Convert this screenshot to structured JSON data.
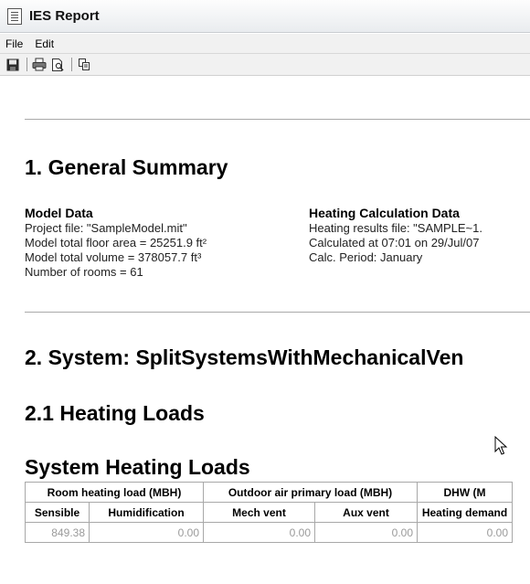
{
  "window": {
    "title": "IES Report"
  },
  "menu": {
    "items": [
      "File",
      "Edit"
    ]
  },
  "toolbar": {
    "buttons": [
      "save-icon",
      "print-icon",
      "print-preview-icon",
      "copy-icon"
    ]
  },
  "report": {
    "section1_title": "1. General Summary",
    "model_data": {
      "heading": "Model Data",
      "lines": [
        "Project file: \"SampleModel.mit\"",
        "Model total floor area = 25251.9 ft²",
        "Model total volume = 378057.7 ft³",
        "Number of rooms = 61"
      ]
    },
    "heating_data": {
      "heading": "Heating Calculation Data",
      "lines": [
        "Heating results file: \"SAMPLE~1.",
        "Calculated at 07:01 on 29/Jul/07",
        "Calc. Period: January"
      ]
    },
    "section2_title": "2. System: SplitSystemsWithMechanicalVen",
    "section21_title": "2.1 Heating Loads",
    "table_title": "System Heating Loads",
    "table": {
      "group_headers": [
        "Room heating load (MBH)",
        "Outdoor air primary load (MBH)",
        "DHW (M"
      ],
      "sub_headers": [
        "Sensible",
        "Humidification",
        "Mech vent",
        "Aux vent",
        "Heating demand"
      ],
      "first_row": [
        "849.38",
        "0.00",
        "0.00",
        "0.00",
        "0.00"
      ]
    }
  }
}
